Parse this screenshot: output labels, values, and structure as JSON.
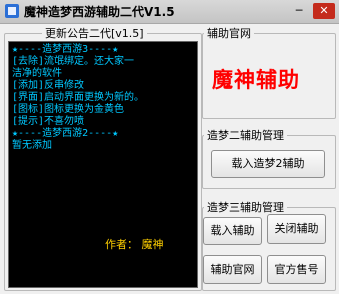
{
  "window": {
    "title": "魔神造梦西游辅助二代V1.5",
    "minimize": "─",
    "close": "✕"
  },
  "announce": {
    "group_label": "更新公告二代[v1.5]",
    "lines": [
      "★----造梦西游3----★",
      "[去除]流氓绑定。还大家一",
      "洁净的软件",
      "[添加]反串修改",
      "[界面]启动界面更换为新的。",
      "[图标]图标更换为金黄色",
      "[提示]不喜勿喷",
      "★----造梦西游2----★",
      "暂无添加"
    ],
    "author": "作者：  魔神"
  },
  "site_group": {
    "label": "辅助官网",
    "brand_text": "魔神辅助"
  },
  "zm2_group": {
    "label": "造梦二辅助管理",
    "load_button": "载入造梦2辅助"
  },
  "zm3_group": {
    "label": "造梦三辅助管理",
    "load_button": "载入辅助",
    "close_button": "关闭辅助",
    "site_button": "辅助官网",
    "account_button": "官方售号"
  }
}
